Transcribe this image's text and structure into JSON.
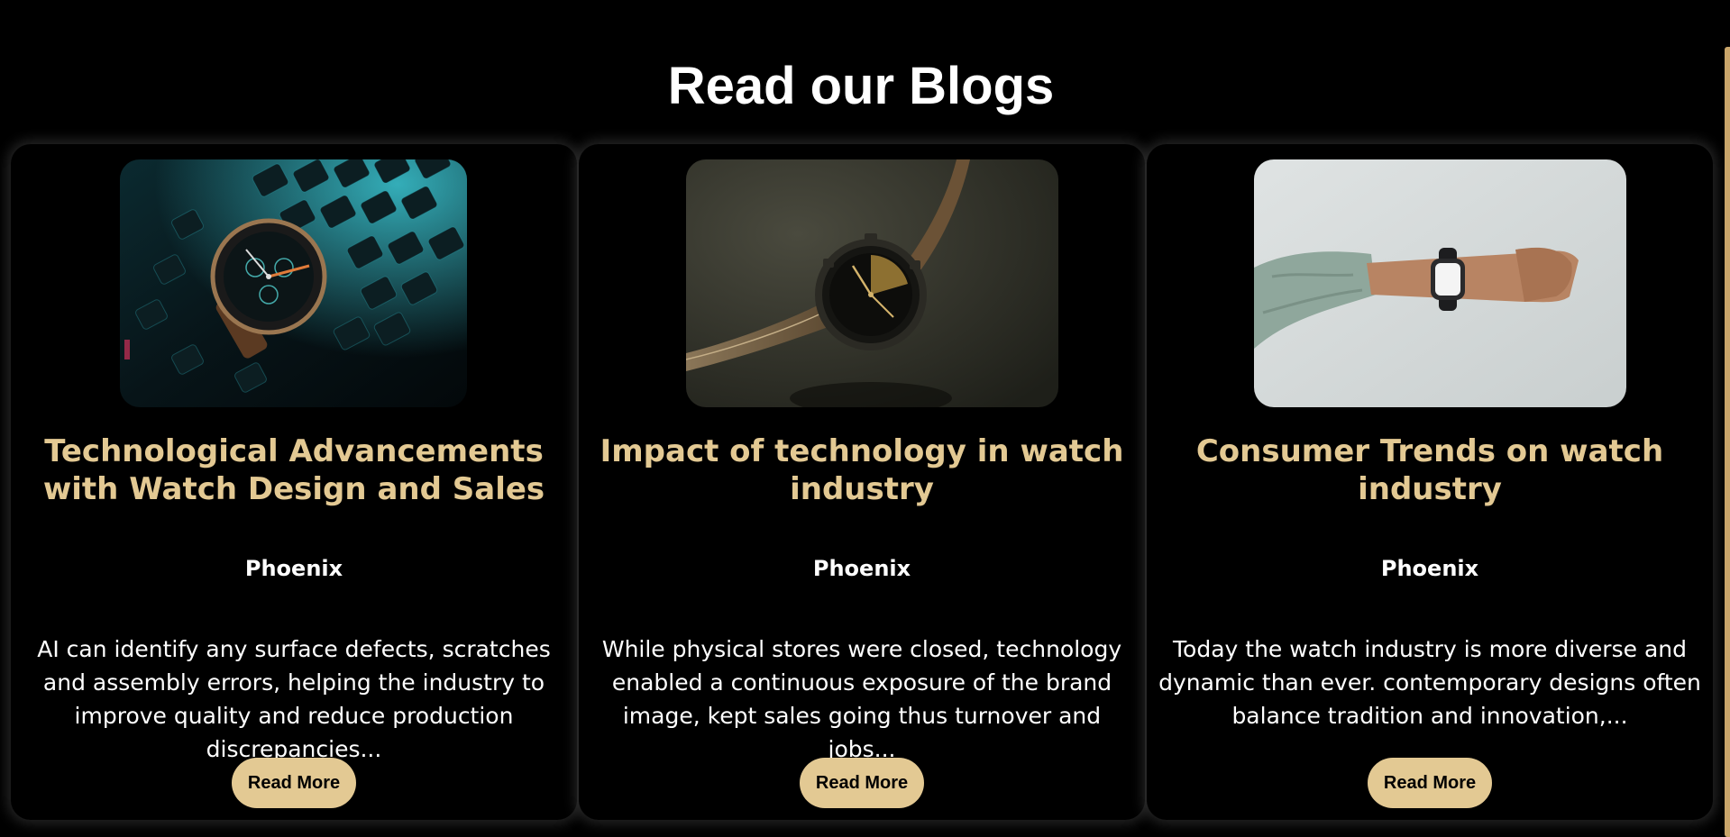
{
  "section": {
    "title": "Read our Blogs"
  },
  "colors": {
    "background": "#000000",
    "accent": "#e3c993",
    "text": "#ffffff"
  },
  "blogs": [
    {
      "image_icon": "watch-on-keyboard-photo",
      "title": "Technological Advancements with Watch Design and Sales",
      "author": "Phoenix",
      "excerpt": "AI can identify any surface defects, scratches and assembly errors, helping the industry to improve quality and reduce production discrepancies...",
      "button_label": "Read More"
    },
    {
      "image_icon": "leather-strap-watch-photo",
      "title": "Impact of technology in watch industry",
      "author": "Phoenix",
      "excerpt": "While physical stores were closed, technology enabled a continuous exposure of the brand image, kept sales going thus turnover and jobs...",
      "button_label": "Read More"
    },
    {
      "image_icon": "smartwatch-on-wrist-photo",
      "title": "Consumer Trends on watch industry",
      "author": "Phoenix",
      "excerpt": "Today the watch industry is more diverse and dynamic than ever. contemporary designs often balance tradition and innovation,...",
      "button_label": "Read More"
    }
  ]
}
